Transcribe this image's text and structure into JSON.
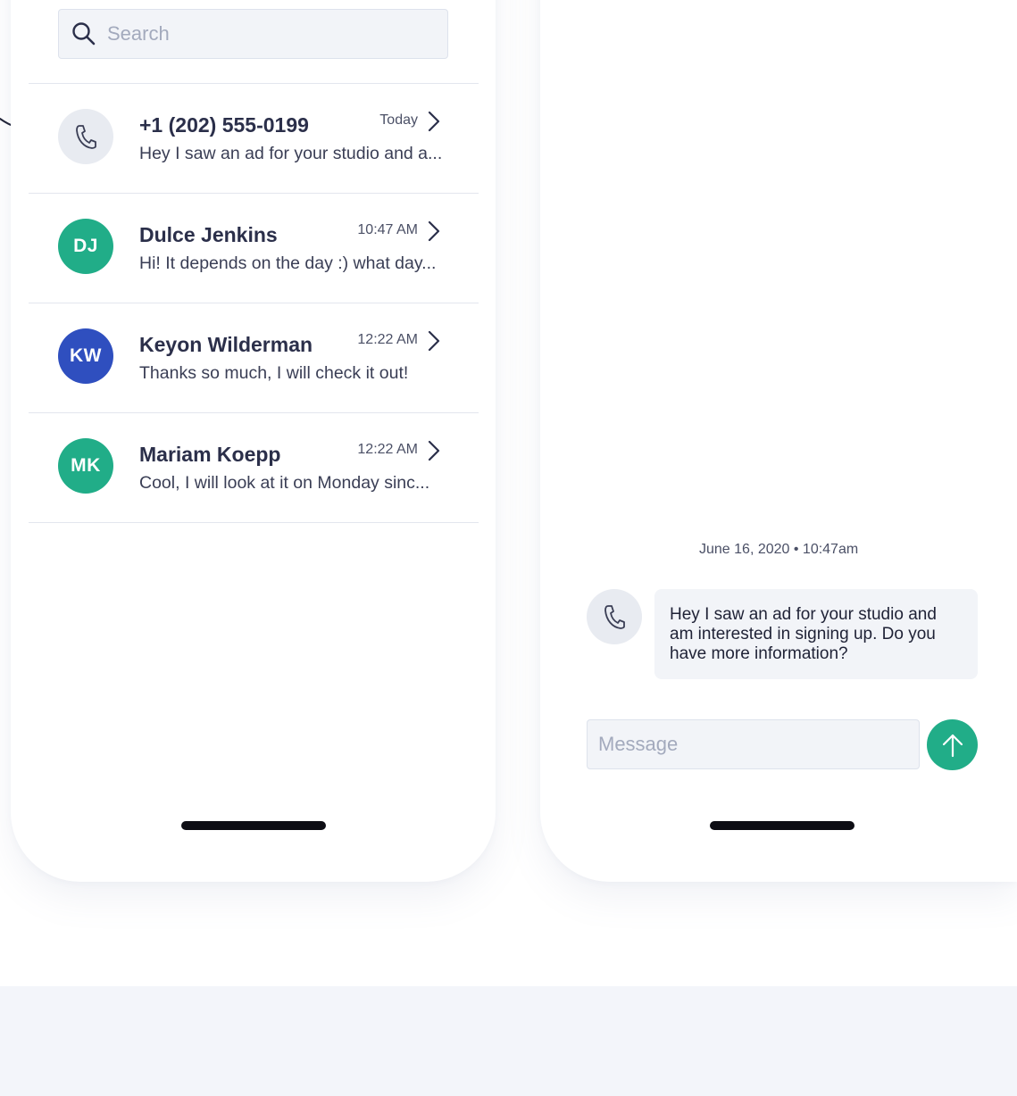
{
  "conversations_panel": {
    "search": {
      "placeholder": "Search",
      "icon": "search-icon"
    },
    "conversations": [
      {
        "name": "+1 (202) 555-0199",
        "preview": "Hey I saw an ad for your studio and a...",
        "time": "Today",
        "avatar_type": "phone-icon",
        "initials": ""
      },
      {
        "name": "Dulce Jenkins",
        "preview": "Hi! It depends on the day :) what day...",
        "time": "10:47 AM",
        "avatar_type": "initials",
        "initials": "DJ",
        "avatar_color": "#21ad88"
      },
      {
        "name": "Keyon Wilderman",
        "preview": "Thanks so much, I will check it out!",
        "time": "12:22 AM",
        "avatar_type": "initials",
        "initials": "KW",
        "avatar_color": "#2f4fbf"
      },
      {
        "name": "Mariam Koepp",
        "preview": "Cool, I will look at it  on Monday sinc...",
        "time": "12:22 AM",
        "avatar_type": "initials",
        "initials": "MK",
        "avatar_color": "#21ad88"
      }
    ]
  },
  "chat_panel": {
    "timestamp": "June 16, 2020 • 10:47am",
    "message": {
      "lines": [
        "Hey I saw an ad for your studio and",
        "am interested in signing up. Do you",
        "have more information?"
      ],
      "sender_avatar": "phone-icon"
    },
    "input": {
      "placeholder": "Message"
    },
    "send_icon": "arrow-up-icon"
  },
  "colors": {
    "accent_green": "#21ad88",
    "accent_blue": "#2f4fbf",
    "text_dark": "#2b2f4a",
    "background_band": "#f3f5fa"
  }
}
